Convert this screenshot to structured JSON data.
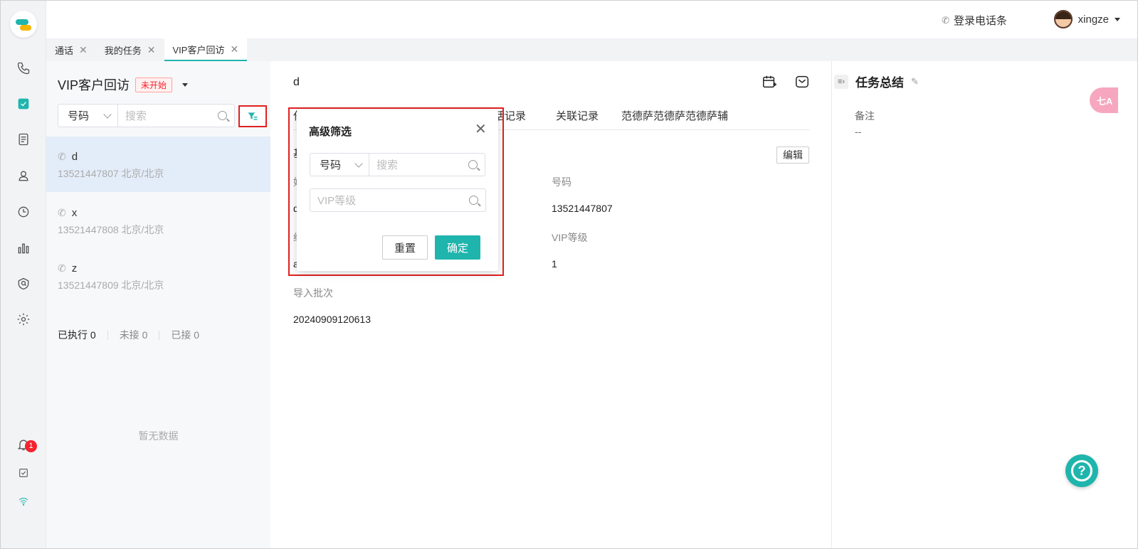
{
  "header": {
    "phone_login": "登录电话条",
    "username": "xingze"
  },
  "tabs": [
    {
      "label": "通话",
      "close": "✕"
    },
    {
      "label": "我的任务",
      "close": "✕"
    },
    {
      "label": "VIP客户回访",
      "close": "✕"
    }
  ],
  "sidebar": {
    "notification_badge": "1",
    "icons": [
      "phone-icon",
      "task-icon",
      "document-icon",
      "contact-icon",
      "clock-icon",
      "bar-chart-icon",
      "shield-icon",
      "gear-icon",
      "bell-icon",
      "checklist-icon",
      "wifi-icon"
    ]
  },
  "task_list": {
    "title": "VIP客户回访",
    "status": "未开始",
    "search_select": "号码",
    "search_placeholder": "搜索",
    "items": [
      {
        "name": "d",
        "phone_location": "13521447807 北京/北京"
      },
      {
        "name": "x",
        "phone_location": "13521447808 北京/北京"
      },
      {
        "name": "z",
        "phone_location": "13521447809 北京/北京"
      }
    ],
    "stats": {
      "executed": "已执行 0",
      "unanswered": "未接 0",
      "answered": "已接 0"
    },
    "empty": "暂无数据"
  },
  "detail": {
    "name": "d",
    "tabs": [
      "任",
      "话记录",
      "关联记录",
      "范德萨范德萨范德萨辅"
    ],
    "section_partial": "基",
    "edit_label": "编辑",
    "fields": {
      "label_left_1": "姓",
      "value_left_1": "d",
      "label_left_2": "级",
      "value_left_2": "a",
      "number_label": "号码",
      "number_value": "13521447807",
      "vip_label": "VIP等级",
      "vip_value": "1",
      "batch_label": "导入批次",
      "batch_value": "20240909120613"
    }
  },
  "summary": {
    "title": "任务总结",
    "note_label": "备注",
    "note_value": "--",
    "translate_label": "七A"
  },
  "filter_popover": {
    "title": "高级筛选",
    "select": "号码",
    "search_placeholder": "搜索",
    "vip_placeholder": "VIP等级",
    "reset_label": "重置",
    "confirm_label": "确定"
  },
  "colors": {
    "accent": "#1fb5ad",
    "highlight_box": "#e02020",
    "status_red": "#f5222d"
  }
}
